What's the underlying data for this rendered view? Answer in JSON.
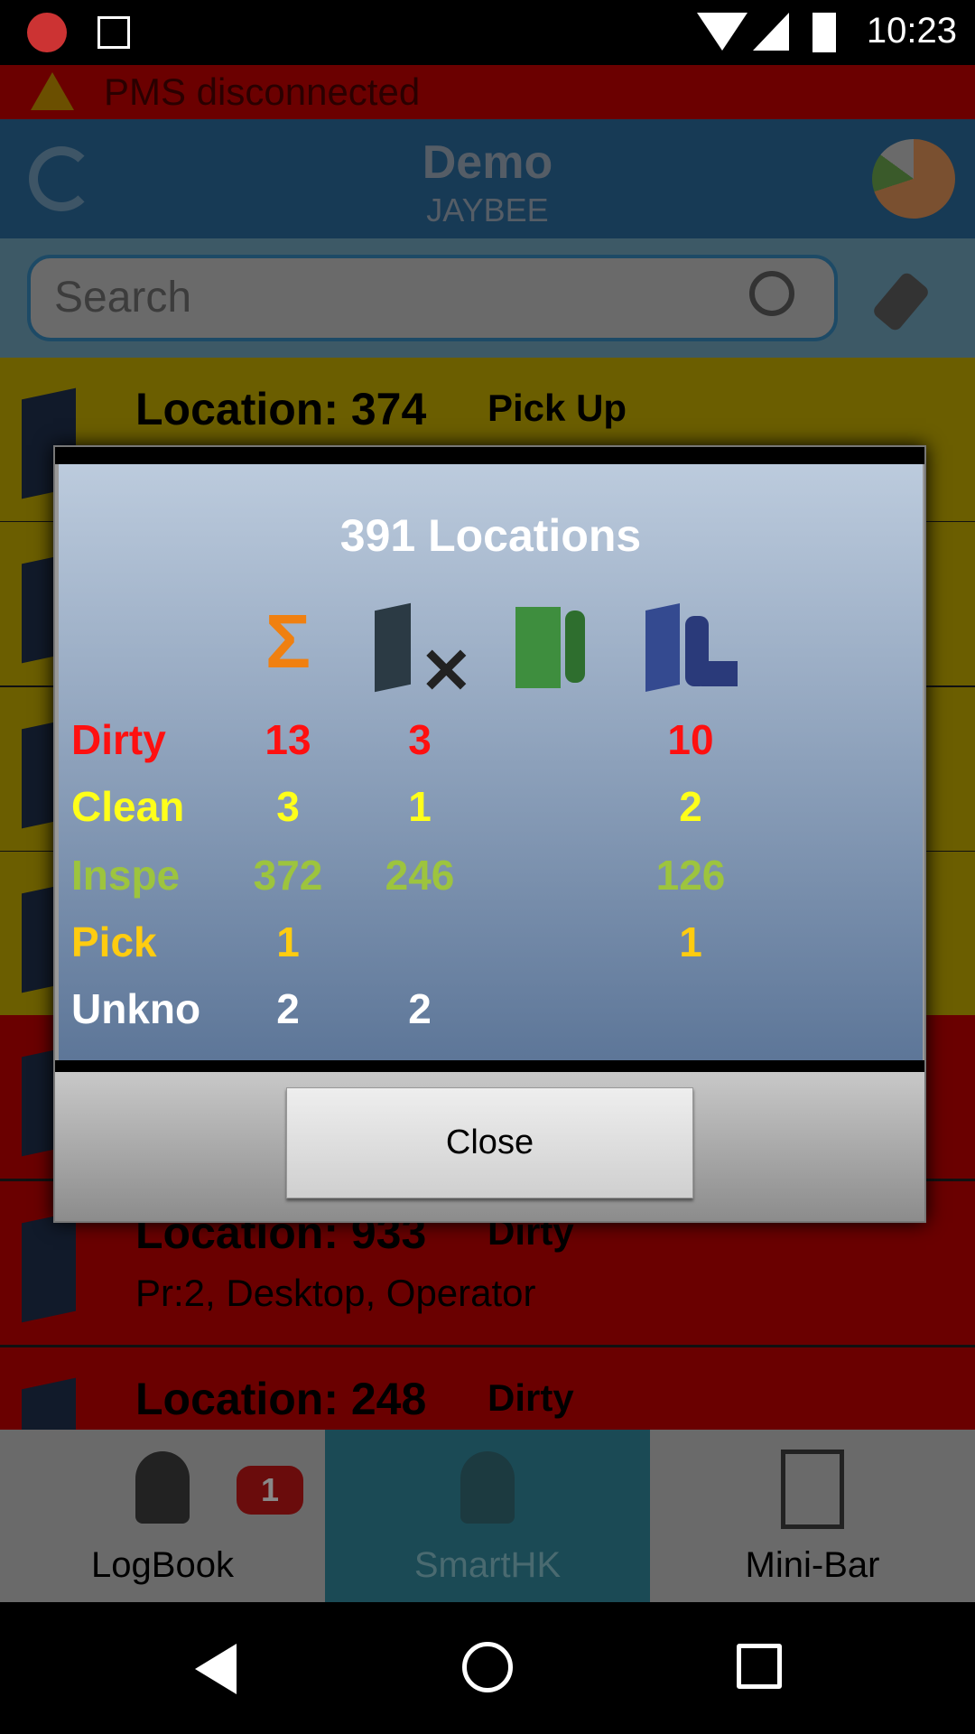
{
  "status_bar": {
    "time": "10:23"
  },
  "banner": {
    "text": "PMS disconnected"
  },
  "header": {
    "title": "Demo",
    "subtitle": "JAYBEE"
  },
  "search": {
    "placeholder": "Search"
  },
  "list": [
    {
      "location": "Location: 374",
      "status": "Pick Up",
      "color": "yellow"
    },
    {
      "location": "",
      "status": "",
      "color": "yellow"
    },
    {
      "location": "",
      "status": "",
      "color": "yellow"
    },
    {
      "location": "",
      "status": "",
      "color": "yellow"
    },
    {
      "location": "",
      "status": "",
      "color": "red"
    },
    {
      "location": "Location: 933",
      "status": "Dirty",
      "detail": "Pr:2, Desktop, Operator",
      "color": "red"
    },
    {
      "location": "Location: 248",
      "status": "Dirty",
      "color": "red"
    }
  ],
  "dialog": {
    "title": "391 Locations",
    "columns": [
      "sum-icon",
      "vacant-icon",
      "occupied-icon",
      "departure-icon"
    ],
    "rows": [
      {
        "label": "Dirty",
        "color": "#ff1010",
        "values": [
          "13",
          "3",
          "",
          "10"
        ]
      },
      {
        "label": "Clean",
        "color": "#ffff1a",
        "values": [
          "3",
          "1",
          "",
          "2"
        ]
      },
      {
        "label": "Inspe",
        "color": "#9dc43e",
        "values": [
          "372",
          "246",
          "",
          "126"
        ]
      },
      {
        "label": "Pick",
        "color": "#ffcc10",
        "values": [
          "1",
          "",
          "",
          "1"
        ]
      },
      {
        "label": "Unkno",
        "color": "#ffffff",
        "values": [
          "2",
          "2",
          "",
          ""
        ]
      }
    ],
    "close_label": "Close"
  },
  "bottom_nav": {
    "tabs": [
      {
        "label": "LogBook",
        "badge": "1"
      },
      {
        "label": "SmartHK",
        "active": true
      },
      {
        "label": "Mini-Bar"
      }
    ]
  }
}
